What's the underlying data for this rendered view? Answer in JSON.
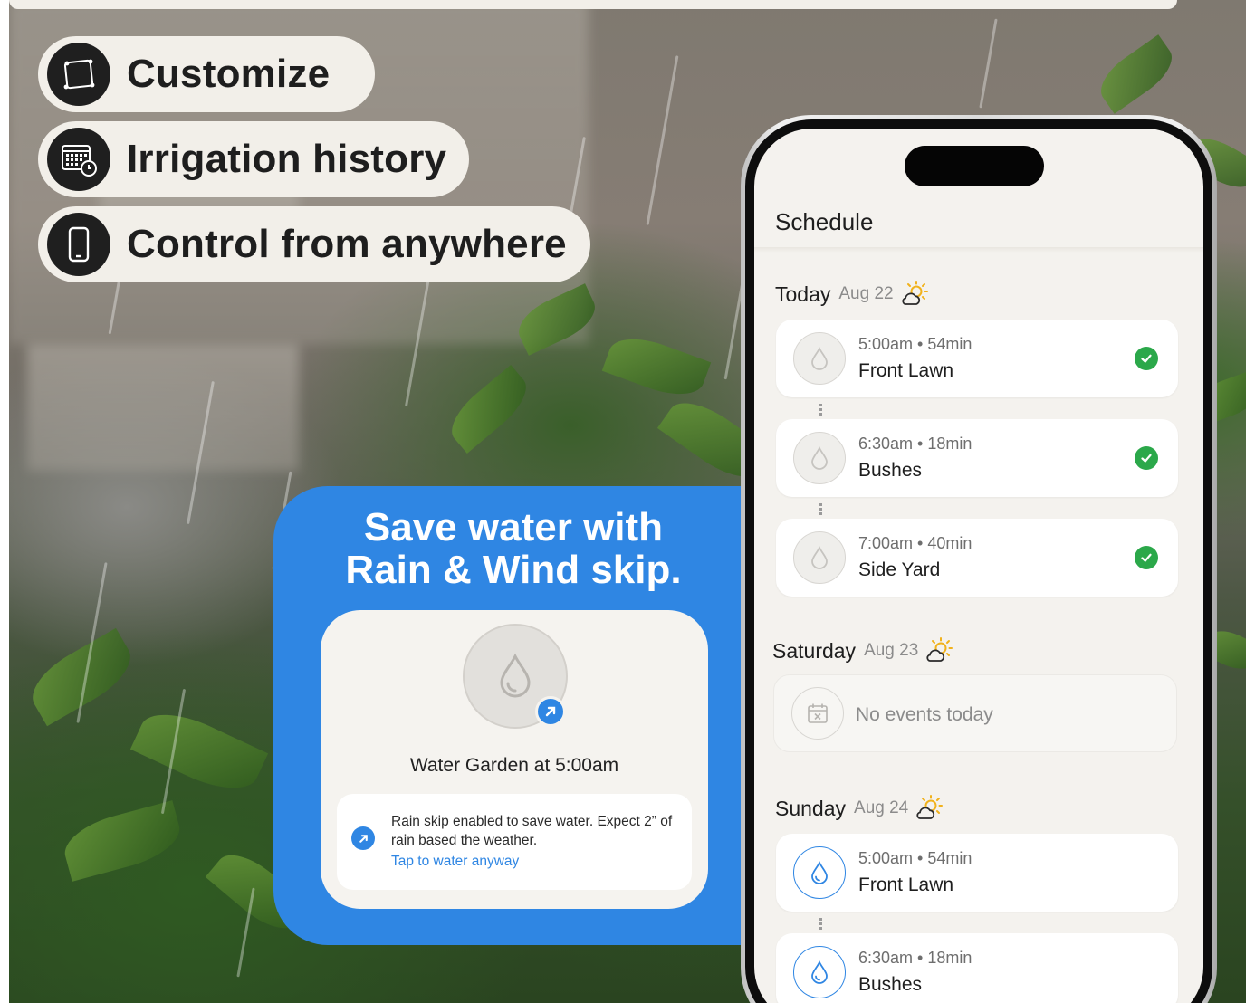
{
  "features": [
    {
      "label": "Customize",
      "icon": "frame-corners-icon"
    },
    {
      "label": "Irrigation history",
      "icon": "calendar-clock-icon"
    },
    {
      "label": "Control from anywhere",
      "icon": "smartphone-icon"
    }
  ],
  "promo": {
    "title_line1": "Save water with",
    "title_line2": "Rain & Wind skip.",
    "water_title": "Water Garden at 5:00am",
    "notice_text": "Rain skip enabled to save water. Expect 2” of rain based the weather.",
    "notice_link": "Tap to water anyway"
  },
  "phone": {
    "title": "Schedule",
    "days": [
      {
        "name": "Today",
        "date": "Aug 22",
        "icon": "sun-cloud-icon"
      },
      {
        "name": "Saturday",
        "date": "Aug 23",
        "icon": "sun-cloud-icon"
      },
      {
        "name": "Sunday",
        "date": "Aug 24",
        "icon": "sun-cloud-icon"
      }
    ],
    "today_events": [
      {
        "time": "5:00am • 54min",
        "name": "Front Lawn",
        "status": "completed"
      },
      {
        "time": "6:30am • 18min",
        "name": "Bushes",
        "status": "completed"
      },
      {
        "time": "7:00am • 40min",
        "name": "Side Yard",
        "status": "completed"
      }
    ],
    "saturday_empty": "No events today",
    "sunday_events": [
      {
        "time": "5:00am • 54min",
        "name": "Front Lawn",
        "status": "upcoming"
      },
      {
        "time": "6:30am • 18min",
        "name": "Bushes",
        "status": "upcoming"
      }
    ]
  },
  "colors": {
    "accent_blue": "#2f86e3",
    "check_green": "#2ba84a",
    "pill_bg": "#f2efe9"
  }
}
